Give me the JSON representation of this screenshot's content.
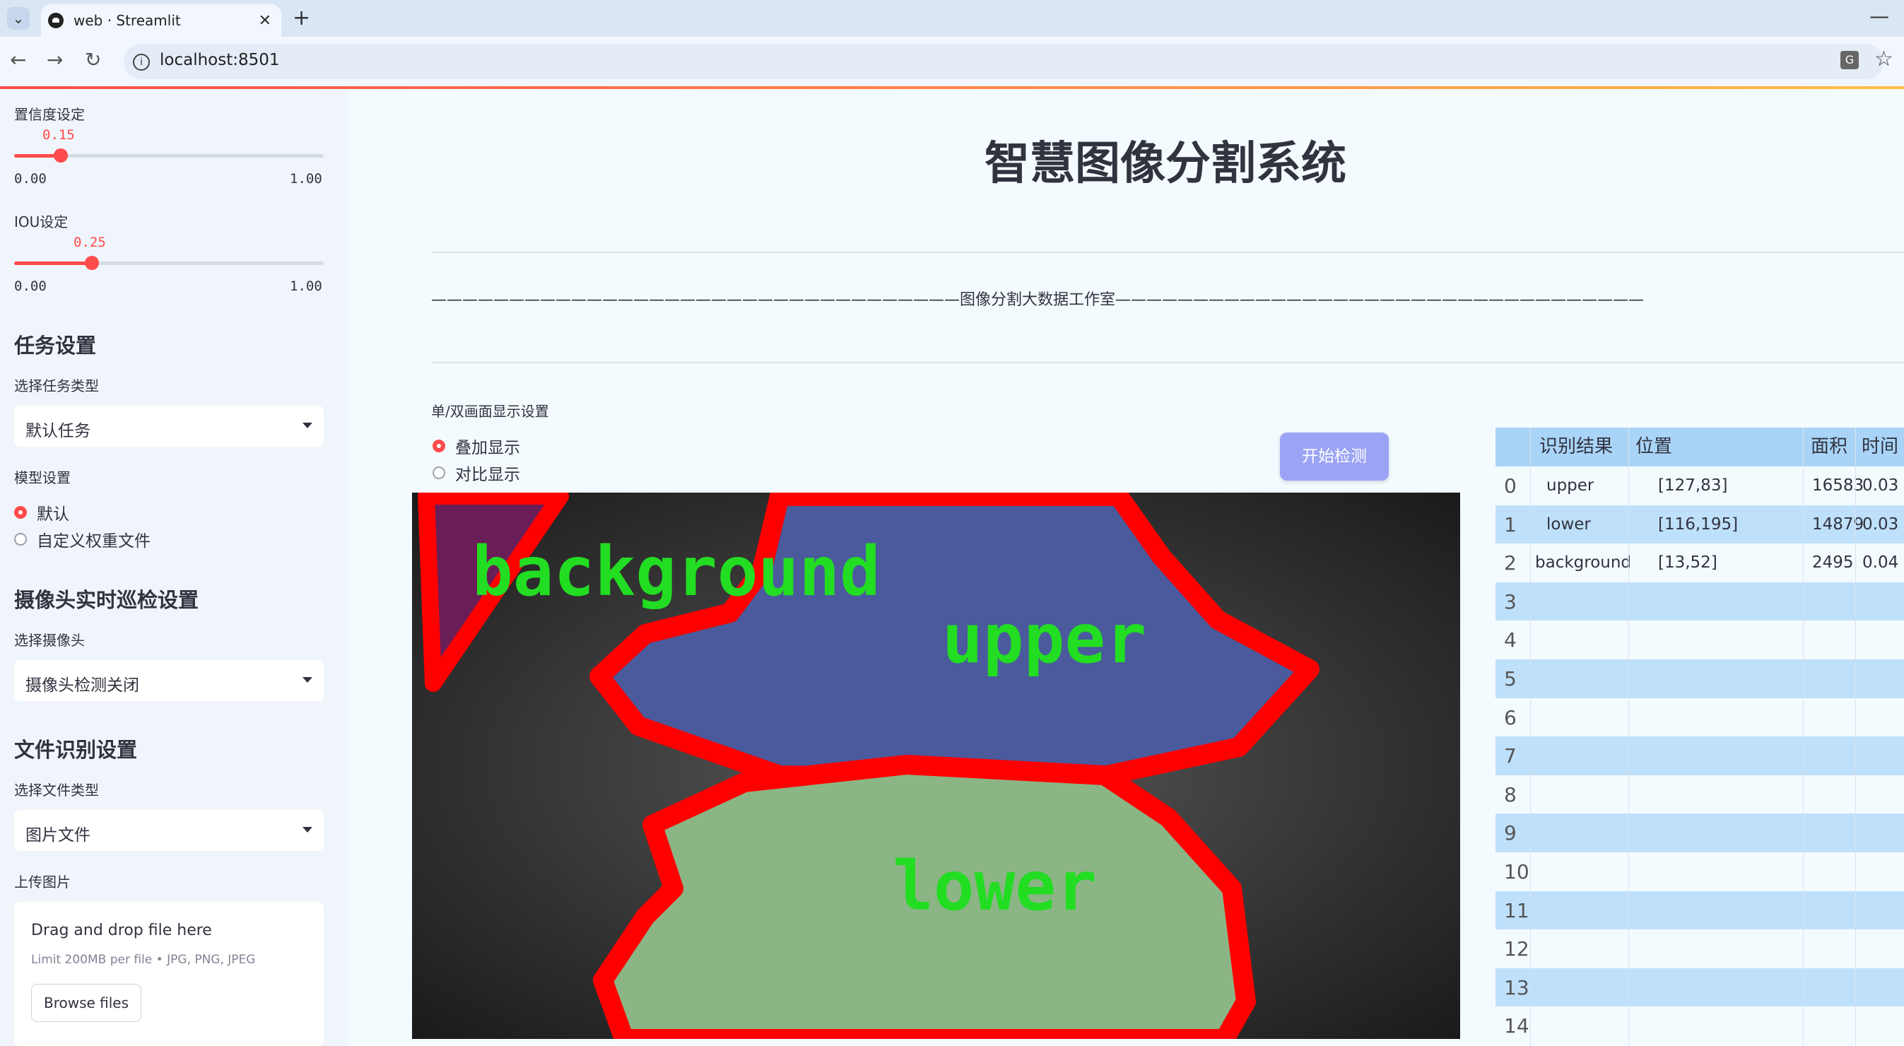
{
  "browser": {
    "tab_title": "web · Streamlit",
    "url": "localhost:8501"
  },
  "sidebar": {
    "confidence": {
      "label": "置信度设定",
      "value": "0.15",
      "min": "0.00",
      "max": "1.00",
      "fraction": 0.15
    },
    "iou": {
      "label": "IOU设定",
      "value": "0.25",
      "min": "0.00",
      "max": "1.00",
      "fraction": 0.25
    },
    "task_heading": "任务设置",
    "task_type_label": "选择任务类型",
    "task_type_value": "默认任务",
    "model_label": "模型设置",
    "model_options": [
      {
        "label": "默认",
        "selected": true
      },
      {
        "label": "自定义权重文件",
        "selected": false
      }
    ],
    "camera_heading": "摄像头实时巡检设置",
    "camera_label": "选择摄像头",
    "camera_value": "摄像头检测关闭",
    "file_heading": "文件识别设置",
    "file_type_label": "选择文件类型",
    "file_type_value": "图片文件",
    "upload_label": "上传图片",
    "upload_drag": "Drag and drop file here",
    "upload_limit": "Limit 200MB per file • JPG, PNG, JPEG",
    "upload_button": "Browse files"
  },
  "main": {
    "title": "智慧图像分割系统",
    "studio_line": "——————————————————————————————————图像分割大数据工作室——————————————————————————————————",
    "display_label": "单/双画面显示设置",
    "display_options": [
      {
        "label": "叠加显示",
        "selected": true
      },
      {
        "label": "对比显示",
        "selected": false
      }
    ],
    "detect_button": "开始检测"
  },
  "segmentation_labels": {
    "background": "background",
    "upper": "upper",
    "lower": "lower"
  },
  "table": {
    "headers": [
      "识别结果",
      "位置",
      "面积",
      "时间"
    ],
    "rows": [
      {
        "index": "0",
        "result": "upper",
        "position": "[127,83]",
        "area": "16583",
        "time": "0.03"
      },
      {
        "index": "1",
        "result": "lower",
        "position": "[116,195]",
        "area": "14879",
        "time": "0.03"
      },
      {
        "index": "2",
        "result": "background",
        "position": "[13,52]",
        "area": "2495",
        "time": "0.04"
      },
      {
        "index": "3"
      },
      {
        "index": "4"
      },
      {
        "index": "5"
      },
      {
        "index": "6"
      },
      {
        "index": "7"
      },
      {
        "index": "8"
      },
      {
        "index": "9"
      },
      {
        "index": "10"
      },
      {
        "index": "11"
      },
      {
        "index": "12"
      },
      {
        "index": "13"
      },
      {
        "index": "14"
      }
    ]
  },
  "colors": {
    "accent": "#ff4b4b",
    "detect_button": "#9ba3f4",
    "table_blue": "#bfe0fb"
  }
}
